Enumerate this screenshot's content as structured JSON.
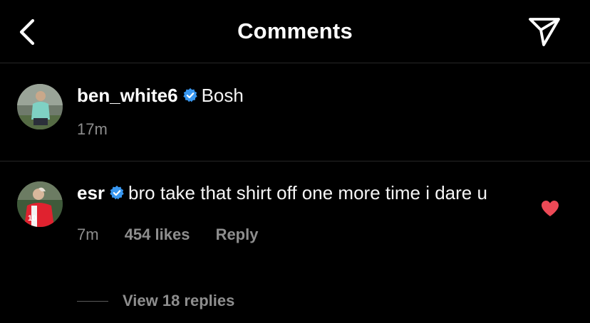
{
  "header": {
    "title": "Comments",
    "back_icon": "chevron-left-icon",
    "share_icon": "paper-plane-icon"
  },
  "comments": [
    {
      "username": "ben_white6",
      "verified": true,
      "text": "Bosh",
      "time": "17m"
    },
    {
      "username": "esr",
      "verified": true,
      "text": "bro take that shirt off one more time i dare u",
      "time": "7m",
      "likes": "454 likes",
      "reply_label": "Reply",
      "liked": true,
      "view_replies": "View 18 replies"
    }
  ],
  "colors": {
    "background": "#000000",
    "verified_blue": "#3897f0",
    "like_red": "#ed4956",
    "meta_gray": "#8e8e8e"
  }
}
